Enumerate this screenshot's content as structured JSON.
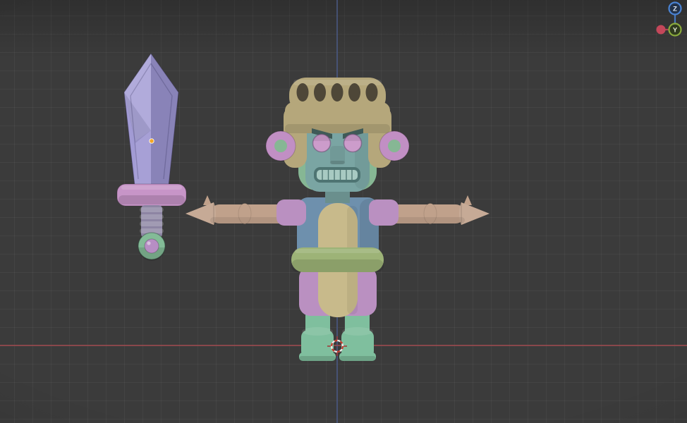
{
  "viewport": {
    "background_color": "#3b3b3b",
    "grid_color": "rgba(255,255,255,0.045)",
    "x_axis_color": "#9e4a4e",
    "z_axis_color": "#4c5c8a"
  },
  "gizmo": {
    "axis_z": {
      "label": "Z",
      "ring_color": "#4a83d4"
    },
    "axis_y": {
      "label": "Y",
      "ring_color": "#8aab3c"
    },
    "axis_x_negative": {
      "color": "#c4475a"
    }
  },
  "scene": {
    "sword": {
      "blade_color": "#a29bd4",
      "guard_color": "#c795c8",
      "grip_color": "#8d85a3",
      "pommel_ring_color": "#83bb97",
      "pommel_core_color": "#b78ec4",
      "origin_point_color": "#f5a623"
    },
    "character": {
      "helmet_color": "#b5a77b",
      "helmet_hole_color": "#4e4738",
      "hair_color": "#86b794",
      "face_color": "#7aa5a3",
      "eye_color": "#cc9ccb",
      "brow_color": "#3f5a57",
      "mouth_color": "#4e7472",
      "teeth_color": "#a8cac2",
      "ear_color": "#c18fc4",
      "torso_color": "#6e90ad",
      "panel_color": "#c8ba8b",
      "shoulder_color": "#ba90c1",
      "arm_color": "#c0a18b",
      "belt_color": "#9db377",
      "hip_color": "#ba90c1",
      "leg_color": "#7fbf9e"
    },
    "cursor_3d": {
      "ring_red": "#c0392b",
      "ring_white": "#e8e8e8"
    }
  }
}
